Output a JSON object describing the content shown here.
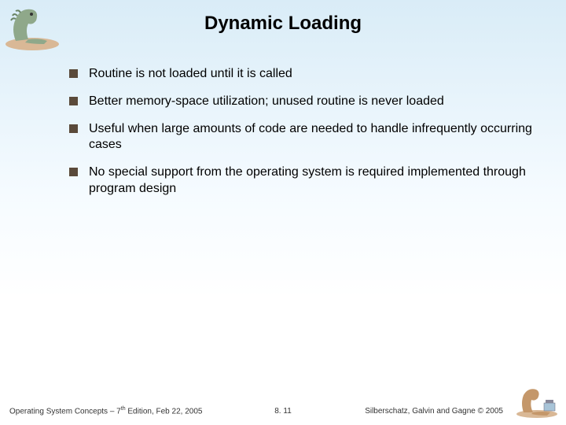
{
  "title": "Dynamic Loading",
  "bullets": [
    "Routine is not loaded until it is called",
    "Better memory-space utilization; unused routine is never loaded",
    "Useful when large amounts of code are needed to handle infrequently occurring cases",
    "No special support from the operating system is required implemented through program design"
  ],
  "footer": {
    "left_prefix": "Operating System Concepts – 7",
    "left_suffix": " Edition, Feb 22, 2005",
    "ordinal": "th",
    "center": "8. 11",
    "right": "Silberschatz, Galvin and Gagne © 2005"
  }
}
